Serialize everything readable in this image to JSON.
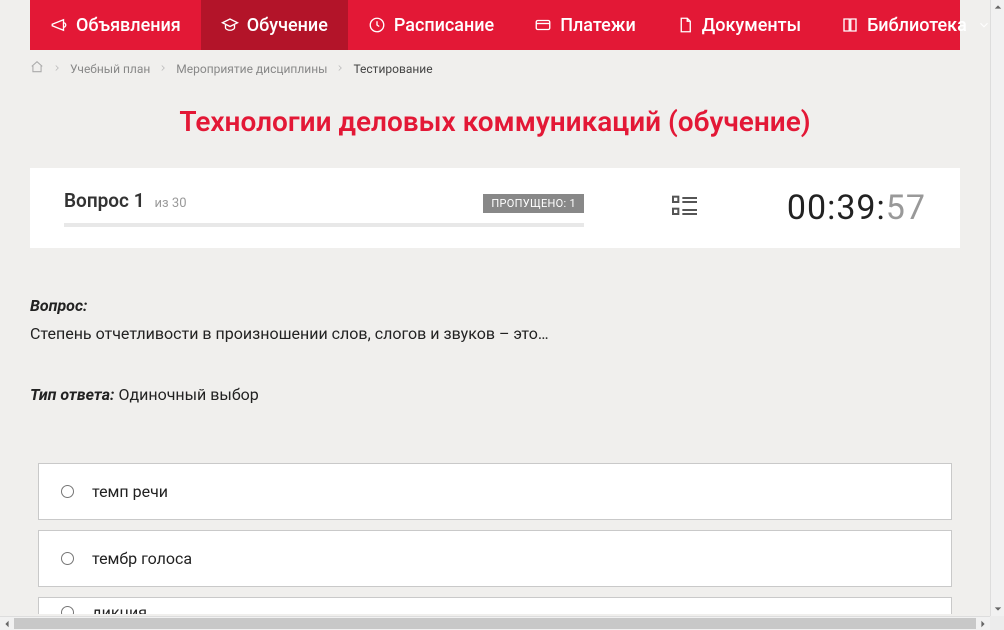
{
  "nav": {
    "items": [
      {
        "label": "Объявления"
      },
      {
        "label": "Обучение"
      },
      {
        "label": "Расписание"
      },
      {
        "label": "Платежи"
      },
      {
        "label": "Документы"
      },
      {
        "label": "Библиотека"
      }
    ]
  },
  "breadcrumb": {
    "items": [
      {
        "label": "Учебный план"
      },
      {
        "label": "Мероприятие дисциплины"
      },
      {
        "label": "Тестирование"
      }
    ]
  },
  "page_title": "Технологии деловых коммуникаций (обучение)",
  "status": {
    "question_word": "Вопрос",
    "current": "1",
    "total_prefix": "из",
    "total": "30",
    "skipped_label": "ПРОПУЩЕНО: 1"
  },
  "timer": {
    "mm": "00",
    "ss": "39",
    "ms": "57"
  },
  "question": {
    "label": "Вопрос:",
    "text": "Степень отчетливости в произношении слов, слогов и звуков – это…"
  },
  "answer_type": {
    "label": "Тип ответа:",
    "value": "Одиночный выбор"
  },
  "options": [
    {
      "text": "темп речи"
    },
    {
      "text": "тембр голоса"
    },
    {
      "text": "дикция"
    }
  ]
}
